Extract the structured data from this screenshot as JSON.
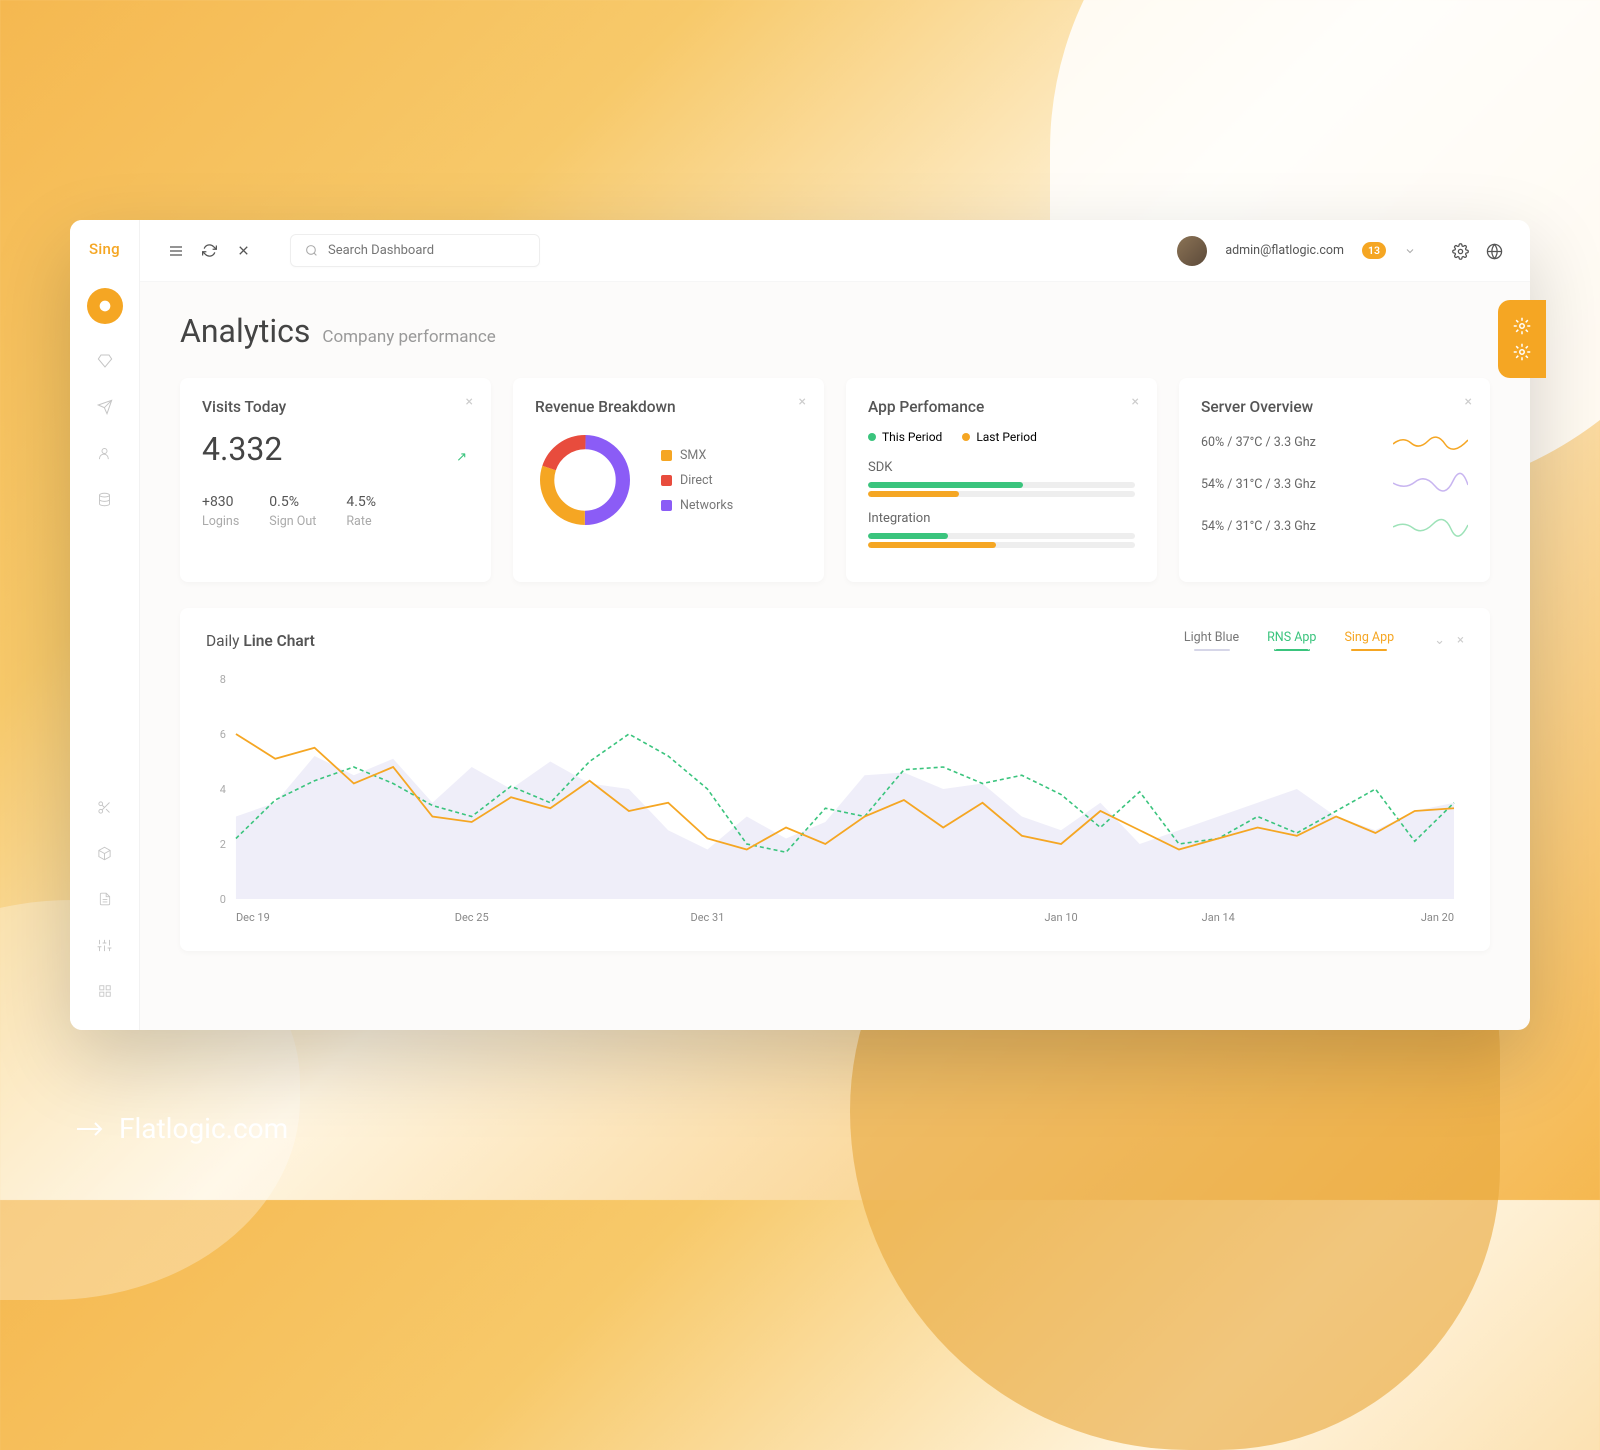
{
  "brand": "Sing",
  "search": {
    "placeholder": "Search Dashboard"
  },
  "user": {
    "email": "admin@flatlogic.com",
    "badge": "13"
  },
  "page": {
    "title": "Analytics",
    "subtitle": "Company performance"
  },
  "visits": {
    "title": "Visits Today",
    "value": "4.332",
    "stats": [
      {
        "value": "+830",
        "label": "Logins"
      },
      {
        "value": "0.5%",
        "label": "Sign Out"
      },
      {
        "value": "4.5%",
        "label": "Rate"
      }
    ]
  },
  "revenue": {
    "title": "Revenue Breakdown",
    "legend": [
      {
        "label": "SMX",
        "color": "#f5a623"
      },
      {
        "label": "Direct",
        "color": "#e84c3d"
      },
      {
        "label": "Networks",
        "color": "#8b5cf6"
      }
    ]
  },
  "app_perf": {
    "title": "App Perfomance",
    "periods": [
      {
        "label": "This Period",
        "color": "#3ac47d"
      },
      {
        "label": "Last Period",
        "color": "#f5a623"
      }
    ],
    "items": [
      {
        "label": "SDK",
        "this": 58,
        "last": 34
      },
      {
        "label": "Integration",
        "this": 30,
        "last": 48
      }
    ]
  },
  "server": {
    "title": "Server Overview",
    "lines": [
      {
        "text": "60% / 37°C / 3.3 Ghz",
        "color": "#f5a623"
      },
      {
        "text": "54% / 31°C / 3.3 Ghz",
        "color": "#8b5cf6"
      },
      {
        "text": "54% / 31°C / 3.3 Ghz",
        "color": "#3ac47d"
      }
    ]
  },
  "chart": {
    "title_pre": "Daily ",
    "title_bold": "Line Chart",
    "legend": [
      {
        "label": "Light Blue",
        "color": "#d6d6e8",
        "style": "solid"
      },
      {
        "label": "RNS App",
        "color": "#3ac47d",
        "style": "dashed"
      },
      {
        "label": "Sing App",
        "color": "#f5a623",
        "style": "solid"
      }
    ]
  },
  "footer": "Flatlogic.com",
  "chart_data": {
    "type": "line",
    "ylabel": "",
    "xlabel": "",
    "ylim": [
      0,
      8
    ],
    "y_ticks": [
      0,
      2,
      4,
      6,
      8
    ],
    "x_ticks": [
      "Dec 19",
      "Dec 25",
      "Dec 31",
      "Jan 10",
      "Jan 14",
      "Jan 20"
    ],
    "x": [
      0,
      1,
      2,
      3,
      4,
      5,
      6,
      7,
      8,
      9,
      10,
      11,
      12,
      13,
      14,
      15,
      16,
      17,
      18,
      19,
      20,
      21,
      22,
      23,
      24,
      25,
      26,
      27,
      28,
      29,
      30,
      31
    ],
    "series": [
      {
        "name": "Light Blue",
        "color": "#e9e8f5",
        "values": [
          3.0,
          3.5,
          5.2,
          4.5,
          5.1,
          3.5,
          4.8,
          4.0,
          5.0,
          4.2,
          4.0,
          2.5,
          1.8,
          3.0,
          2.2,
          2.8,
          4.5,
          4.6,
          4.0,
          4.2,
          3.0,
          2.5,
          3.5,
          2.0,
          2.5,
          3.0,
          3.5,
          4.0,
          3.0,
          2.5,
          3.2,
          3.5
        ]
      },
      {
        "name": "RNS App",
        "color": "#3ac47d",
        "values": [
          2.2,
          3.6,
          4.3,
          4.8,
          4.2,
          3.4,
          3.0,
          4.1,
          3.5,
          5.0,
          6.0,
          5.2,
          4.0,
          2.0,
          1.7,
          3.3,
          3.0,
          4.7,
          4.8,
          4.2,
          4.5,
          3.8,
          2.6,
          3.9,
          2.0,
          2.2,
          3.0,
          2.4,
          3.2,
          4.0,
          2.1,
          3.5
        ]
      },
      {
        "name": "Sing App",
        "color": "#f5a623",
        "values": [
          6.0,
          5.1,
          5.5,
          4.2,
          4.8,
          3.0,
          2.8,
          3.7,
          3.3,
          4.3,
          3.2,
          3.5,
          2.2,
          1.8,
          2.6,
          2.0,
          3.0,
          3.6,
          2.6,
          3.5,
          2.3,
          2.0,
          3.2,
          2.5,
          1.8,
          2.2,
          2.6,
          2.3,
          3.0,
          2.4,
          3.2,
          3.3
        ]
      }
    ],
    "revenue_donut": {
      "type": "pie",
      "slices": [
        {
          "label": "SMX",
          "value": 30,
          "color": "#f5a623"
        },
        {
          "label": "Direct",
          "value": 20,
          "color": "#e84c3d"
        },
        {
          "label": "Networks",
          "value": 50,
          "color": "#8b5cf6"
        }
      ]
    }
  }
}
